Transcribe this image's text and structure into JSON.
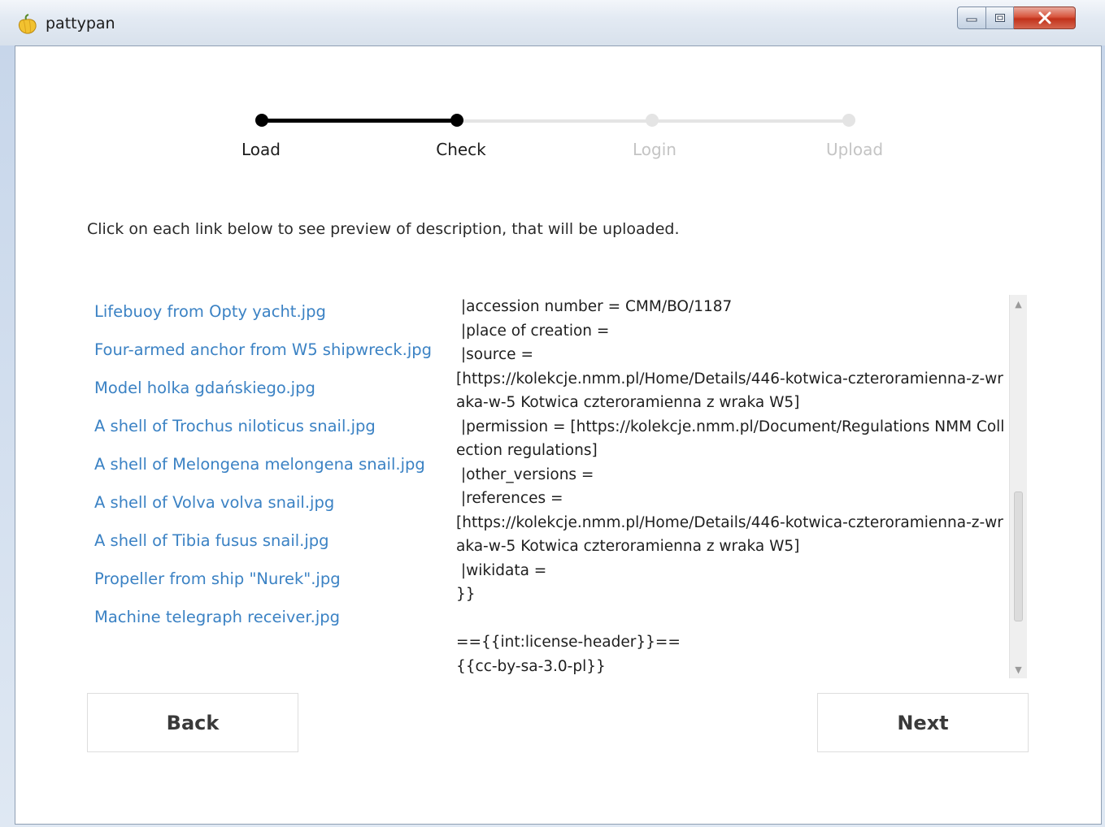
{
  "window": {
    "title": "pattypan",
    "controls": {
      "minimize": "minimize",
      "maximize": "maximize",
      "close": "close"
    }
  },
  "wizard": {
    "steps": [
      {
        "label": "Load",
        "state": "done"
      },
      {
        "label": "Check",
        "state": "current"
      },
      {
        "label": "Login",
        "state": "todo"
      },
      {
        "label": "Upload",
        "state": "todo"
      }
    ],
    "progress": {
      "completed_steps": 2,
      "total_steps": 4
    }
  },
  "instructions": "Click on each link below to see preview of description, that will be uploaded.",
  "files": [
    "Lifebuoy from Opty yacht.jpg",
    "Four-armed anchor from W5 shipwreck.jpg",
    "Model holka gdańskiego.jpg",
    "A shell of Trochus niloticus snail.jpg",
    "A shell of Melongena melongena snail.jpg",
    "A shell of Volva volva snail.jpg",
    "A shell of Tibia fusus snail.jpg",
    "Propeller from ship \"Nurek\".jpg",
    "Machine telegraph receiver.jpg"
  ],
  "preview": {
    "lines": [
      " |accession number = CMM/BO/1187",
      " |place of creation =",
      " |source =",
      "[https://kolekcje.nmm.pl/Home/Details/446-kotwica-czteroramienna-z-wraka-w-5 Kotwica czteroramienna z wraka W5]",
      " |permission = [https://kolekcje.nmm.pl/Document/Regulations NMM Collection regulations]",
      " |other_versions =",
      " |references =",
      "[https://kolekcje.nmm.pl/Home/Details/446-kotwica-czteroramienna-z-wraka-w-5 Kotwica czteroramienna z wraka W5]",
      " |wikidata =",
      "}}",
      "",
      "=={{int:license-header}}==",
      "{{cc-by-sa-3.0-pl}}"
    ],
    "scroll_position": 0.62
  },
  "buttons": {
    "back": "Back",
    "next": "Next"
  },
  "colors": {
    "link": "#3b82c4",
    "step_done": "#000000",
    "step_todo": "#e4e4e4",
    "close_button": "#c2321b"
  }
}
